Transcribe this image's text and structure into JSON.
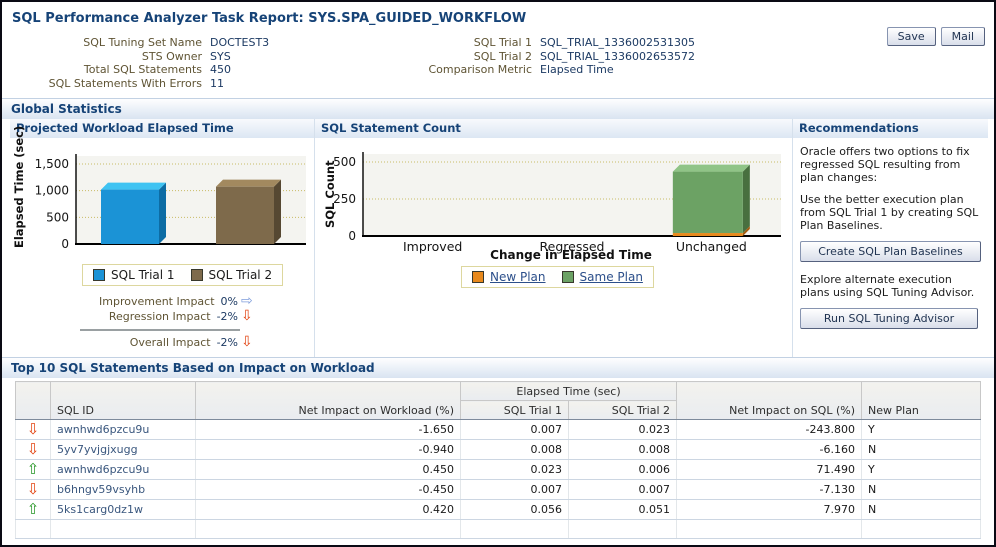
{
  "header": {
    "title": "SQL Performance Analyzer Task Report: SYS.SPA_GUIDED_WORKFLOW",
    "save_label": "Save",
    "mail_label": "Mail"
  },
  "summary": {
    "left": [
      {
        "label": "SQL Tuning Set Name",
        "value": "DOCTEST3"
      },
      {
        "label": "STS Owner",
        "value": "SYS"
      },
      {
        "label": "Total SQL Statements",
        "value": "450"
      },
      {
        "label": "SQL Statements With Errors",
        "value": "11"
      }
    ],
    "right": [
      {
        "label": "SQL Trial 1",
        "value": "SQL_TRIAL_1336002531305"
      },
      {
        "label": "SQL Trial 2",
        "value": "SQL_TRIAL_1336002653572"
      },
      {
        "label": "Comparison Metric",
        "value": "Elapsed Time"
      }
    ]
  },
  "sections": {
    "global_statistics": "Global Statistics"
  },
  "chart_data": [
    {
      "type": "bar",
      "title": "Projected Workload Elapsed Time",
      "categories": [
        "SQL Trial 1",
        "SQL Trial 2"
      ],
      "values": [
        1020,
        1075
      ],
      "colors": [
        {
          "front": "#1b93d6",
          "top": "#3fc3f2",
          "side": "#0d6ca4"
        },
        {
          "front": "#7e6a4b",
          "top": "#a2895f",
          "side": "#564832"
        }
      ],
      "ylabel": "Elapsed Time (sec)",
      "ylim": [
        0,
        1500
      ],
      "yticks": [
        {
          "v": 0,
          "label": "0"
        },
        {
          "v": 500,
          "label": "500"
        },
        {
          "v": 1000,
          "label": "1,000"
        },
        {
          "v": 1500,
          "label": "1,500"
        }
      ],
      "grid": "dotted",
      "legend_position": "bottom",
      "legend": [
        {
          "label": "SQL Trial 1",
          "color": "#1b93d6"
        },
        {
          "label": "SQL Trial 2",
          "color": "#7e6a4b"
        }
      ]
    },
    {
      "type": "bar-stacked",
      "title": "SQL Statement Count",
      "categories": [
        "Improved",
        "Regressed",
        "Unchanged"
      ],
      "series": [
        {
          "name": "New Plan",
          "values": [
            0,
            0,
            20
          ],
          "colors": {
            "front": "#e8891c",
            "top": "#f5ad4e",
            "side": "#a35c10"
          }
        },
        {
          "name": "Same Plan",
          "values": [
            0,
            0,
            415
          ],
          "colors": {
            "front": "#6ca264",
            "top": "#90c487",
            "side": "#48703f"
          }
        }
      ],
      "ylabel": "SQL Count",
      "xlabel": "Change in Elapsed Time",
      "ylim": [
        0,
        500
      ],
      "yticks": [
        {
          "v": 0,
          "label": "0"
        },
        {
          "v": 250,
          "label": "250"
        },
        {
          "v": 500,
          "label": "500"
        }
      ],
      "grid": "dotted",
      "legend_position": "bottom",
      "legend": [
        {
          "label": "New Plan",
          "color": "#e8891c"
        },
        {
          "label": "Same Plan",
          "color": "#6ca264"
        }
      ]
    }
  ],
  "impact": {
    "rows": [
      {
        "label": "Improvement Impact",
        "value": "0%",
        "direction": "right"
      },
      {
        "label": "Regression Impact",
        "value": "-2%",
        "direction": "down"
      }
    ],
    "overall": {
      "label": "Overall Impact",
      "value": "-2%",
      "direction": "down"
    }
  },
  "recommendations": {
    "title": "Recommendations",
    "intro": "Oracle offers two options to fix regressed SQL resulting from plan changes:",
    "option1_text": "Use the better execution plan from SQL Trial 1 by creating SQL Plan Baselines.",
    "option1_button": "Create SQL Plan Baselines",
    "option2_text": "Explore alternate execution plans using SQL Tuning Advisor.",
    "option2_button": "Run SQL Tuning Advisor"
  },
  "table": {
    "section_title": "Top 10 SQL Statements Based on Impact on Workload",
    "elapsed_group_label": "Elapsed Time (sec)",
    "columns": {
      "sql_id": "SQL ID",
      "net_impact_workload": "Net Impact on Workload (%)",
      "trial1": "SQL Trial 1",
      "trial2": "SQL Trial 2",
      "net_impact_sql": "Net Impact on SQL (%)",
      "new_plan": "New Plan"
    },
    "rows": [
      {
        "direction": "down",
        "sql_id": "awnhwd6pzcu9u",
        "net_impact_workload": "-1.650",
        "trial1": "0.007",
        "trial2": "0.023",
        "net_impact_sql": "-243.800",
        "new_plan": "Y"
      },
      {
        "direction": "down",
        "sql_id": "5yv7yvjgjxugg",
        "net_impact_workload": "-0.940",
        "trial1": "0.008",
        "trial2": "0.008",
        "net_impact_sql": "-6.160",
        "new_plan": "N"
      },
      {
        "direction": "up",
        "sql_id": "awnhwd6pzcu9u",
        "net_impact_workload": "0.450",
        "trial1": "0.023",
        "trial2": "0.006",
        "net_impact_sql": "71.490",
        "new_plan": "Y"
      },
      {
        "direction": "down",
        "sql_id": "b6hngv59vsyhb",
        "net_impact_workload": "-0.450",
        "trial1": "0.007",
        "trial2": "0.007",
        "net_impact_sql": "-7.130",
        "new_plan": "N"
      },
      {
        "direction": "up",
        "sql_id": "5ks1carg0dz1w",
        "net_impact_workload": "0.420",
        "trial1": "0.056",
        "trial2": "0.051",
        "net_impact_sql": "7.970",
        "new_plan": "N"
      }
    ]
  }
}
